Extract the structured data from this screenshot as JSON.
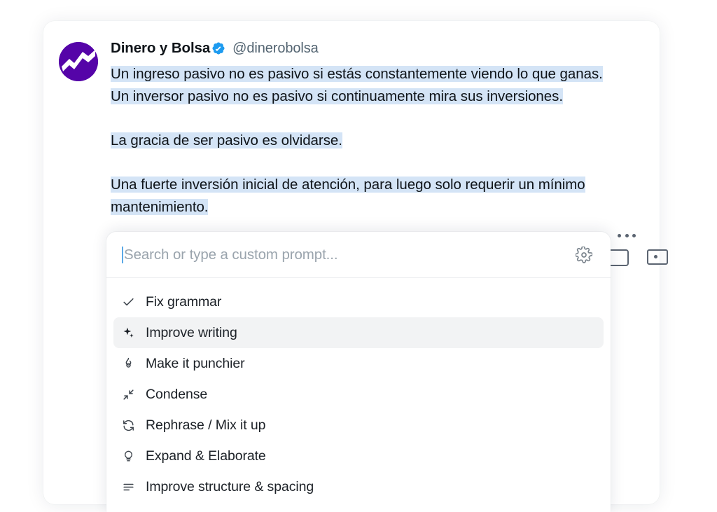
{
  "tweet": {
    "display_name": "Dinero y Bolsa",
    "verified_icon": "verified-badge-icon",
    "handle": "@dinerobolsa",
    "avatar_icon": "chart-zigzag-avatar-icon",
    "paragraphs": [
      "Un ingreso pasivo no es pasivo si estás constantemente viendo lo que ganas.",
      "Un inversor pasivo no es pasivo si continuamente mira sus inversiones.",
      "La gracia de ser pasivo es olvidarse.",
      "Una fuerte inversión inicial de atención, para luego solo requerir un mínimo mantenimiento."
    ],
    "line1": "Un ingreso pasivo no es pasivo si estás constantemente viendo lo que ganas.",
    "line2": "Un inversor pasivo no es pasivo si continuamente mira sus inversiones.",
    "line3": "La gracia de ser pasivo es olvidarse.",
    "line4": "Una fuerte inversión inicial de atención, para luego solo requerir un mínimo mantenimiento.",
    "highlight_color": "#d4e4f6",
    "avatar_color": "#5504a8",
    "verified_color": "#1d9bf0",
    "more_options_icon": "more-horizontal-icon"
  },
  "popup": {
    "search": {
      "value": "",
      "placeholder": "Search or type a custom prompt...",
      "settings_icon": "gear-icon"
    },
    "items": [
      {
        "label": "Fix grammar",
        "icon": "check-icon",
        "active": false
      },
      {
        "label": "Improve writing",
        "icon": "sparkles-icon",
        "active": true
      },
      {
        "label": "Make it punchier",
        "icon": "flame-icon",
        "active": false
      },
      {
        "label": "Condense",
        "icon": "compress-icon",
        "active": false
      },
      {
        "label": "Rephrase / Mix it up",
        "icon": "refresh-icon",
        "active": false
      },
      {
        "label": "Expand & Elaborate",
        "icon": "lightbulb-icon",
        "active": false
      },
      {
        "label": "Improve structure & spacing",
        "icon": "list-lines-icon",
        "active": false
      }
    ],
    "active_item_bg": "#f2f3f4",
    "caret_color": "#5aa9e6"
  }
}
